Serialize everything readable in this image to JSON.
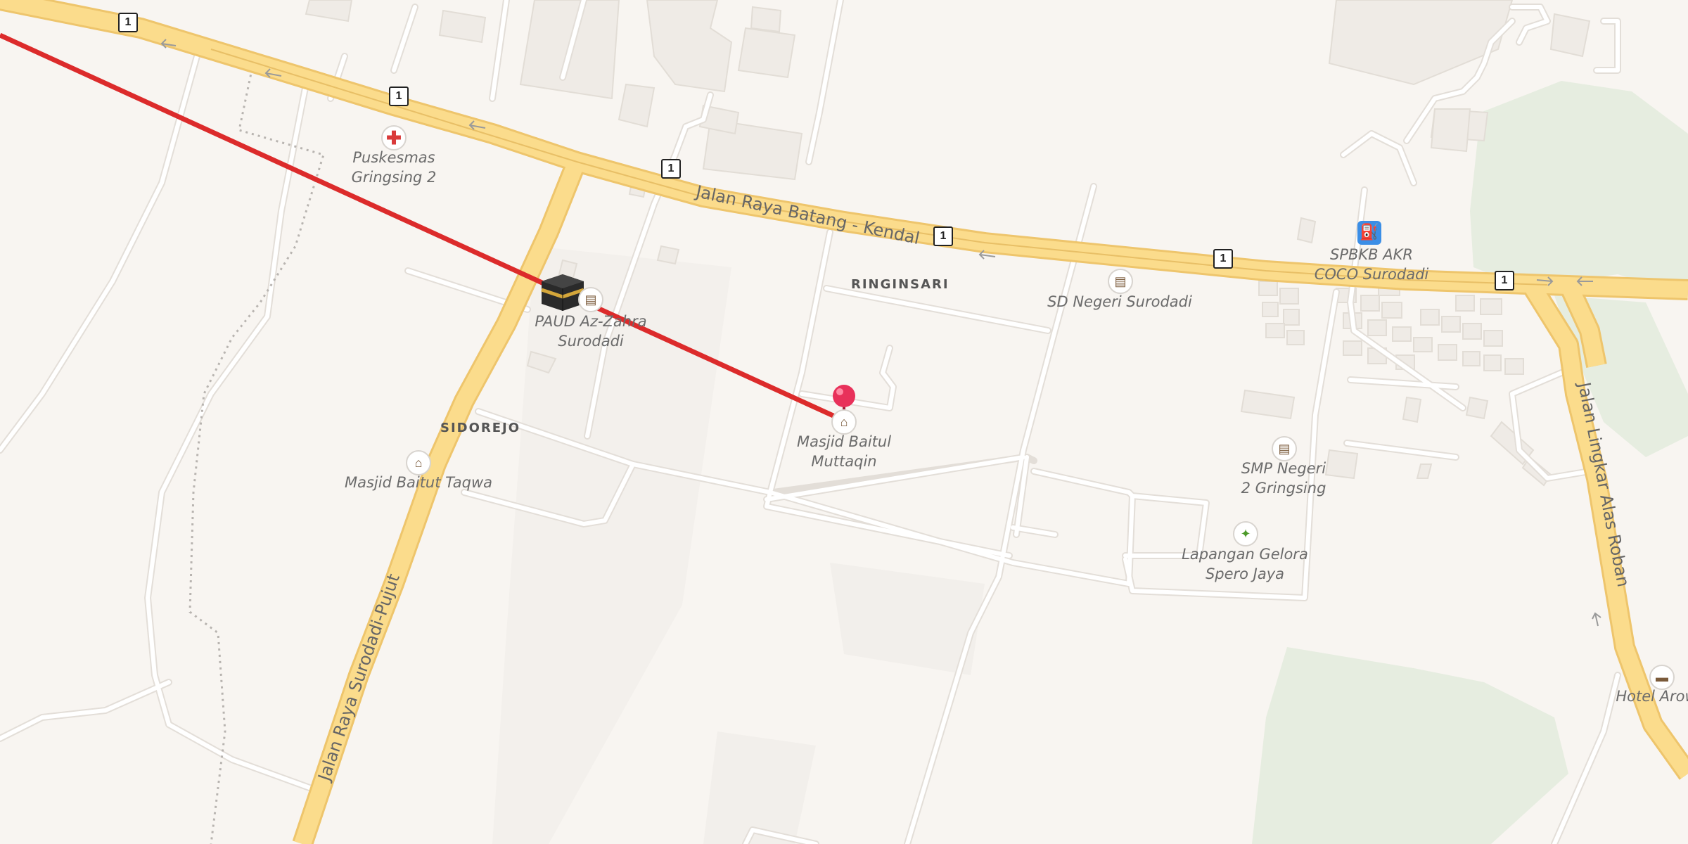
{
  "map": {
    "roads": {
      "main_road_name": "Jalan Raya Batang - Kendal",
      "secondary_road_name": "Jalan Raya Surodadi-Pujut",
      "bypass_road_name": "Jalan Lingkar Alas Roban",
      "route_number": "1"
    },
    "places": [
      {
        "name": "RINGINSARI"
      },
      {
        "name": "SIDOREJO"
      }
    ],
    "pois": [
      {
        "name": "Puskesmas Gringsing 2",
        "line1": "Puskesmas",
        "line2": "Gringsing 2",
        "icon": "medical-cross-icon"
      },
      {
        "name": "PAUD Az-Zahra Surodadi",
        "line1": "PAUD Az-Zahra",
        "line2": "Surodadi",
        "icon": "school-icon"
      },
      {
        "name": "Masjid Baitul Muttaqin",
        "line1": "Masjid Baitul",
        "line2": "Muttaqin",
        "icon": "mosque-icon"
      },
      {
        "name": "Masjid Baitut Taqwa",
        "line1": "Masjid Baitut Taqwa",
        "icon": "mosque-icon"
      },
      {
        "name": "SD Negeri Surodadi",
        "line1": "SD Negeri Surodadi",
        "icon": "school-icon"
      },
      {
        "name": "SPBKB AKR COCO Surodadi",
        "line1": "SPBKB AKR",
        "line2": "COCO Surodadi",
        "icon": "fuel-pump-icon"
      },
      {
        "name": "SMP Negeri 2 Gringsing",
        "line1": "SMP Negeri",
        "line2": "2 Gringsing",
        "icon": "school-icon"
      },
      {
        "name": "Lapangan Gelora Spero Jaya",
        "line1": "Lapangan Gelora",
        "line2": "Spero Jaya",
        "icon": "sports-icon"
      },
      {
        "name": "Hotel Arow",
        "line1": "Hotel Arow",
        "icon": "bed-icon"
      }
    ],
    "markers": {
      "pin": "location-pin-icon",
      "qibla": "kaaba-icon"
    },
    "colors": {
      "background": "#f8f5f1",
      "major_road": "#fbdc8c",
      "major_road_casing": "#eec56c",
      "minor_road": "#ffffff",
      "minor_road_casing": "#e3ded8",
      "qibla_line": "#dc2b2b",
      "pin": "#e8315a",
      "park": "#e6ede0",
      "building": "#efebe6"
    }
  }
}
